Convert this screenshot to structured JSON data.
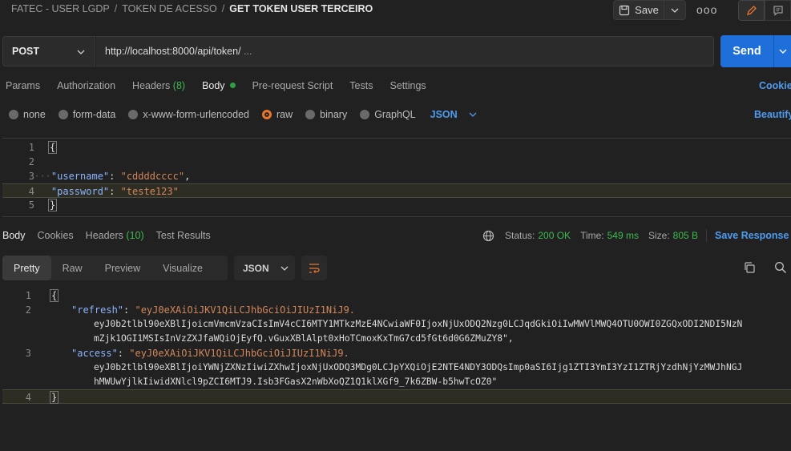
{
  "breadcrumb": [
    "FATEC - USER LGDP",
    "TOKEN DE ACESSO",
    "GET TOKEN USER TERCEIRO"
  ],
  "toolbar": {
    "save_label": "Save",
    "more_label": "ooo"
  },
  "request": {
    "method": "POST",
    "url": "http://localhost:8000/api/token/",
    "url_suffix": "...",
    "send_label": "Send"
  },
  "request_tabs": [
    {
      "label": "Params"
    },
    {
      "label": "Authorization"
    },
    {
      "label": "Headers",
      "count": "(8)"
    },
    {
      "label": "Body",
      "active": true
    },
    {
      "label": "Pre-request Script"
    },
    {
      "label": "Tests"
    },
    {
      "label": "Settings"
    }
  ],
  "cookies_label": "Cookie",
  "body_types": [
    "none",
    "form-data",
    "x-www-form-urlencoded",
    "raw",
    "binary",
    "GraphQL"
  ],
  "body_type_selected": "raw",
  "body_language": "JSON",
  "beautify_label": "Beautify",
  "request_body": {
    "line_numbers": [
      "1",
      "2",
      "3",
      "4",
      "5"
    ],
    "l1": "{",
    "l3_key": "\"username\"",
    "l3_val": "\"cddddcccc\"",
    "l4_key": "\"password\"",
    "l4_val": "\"teste123\"",
    "l5": "}"
  },
  "response_tabs": [
    {
      "label": "Body",
      "active": true
    },
    {
      "label": "Cookies"
    },
    {
      "label": "Headers",
      "count": "(10)"
    },
    {
      "label": "Test Results"
    }
  ],
  "response_meta": {
    "status_label": "Status:",
    "status": "200 OK",
    "time_label": "Time:",
    "time": "549 ms",
    "size_label": "Size:",
    "size": "805 B",
    "save_response": "Save Response"
  },
  "response_views": [
    "Pretty",
    "Raw",
    "Preview",
    "Visualize"
  ],
  "response_format": "JSON",
  "response_body": {
    "line_numbers": [
      "1",
      "2",
      "3",
      "4"
    ],
    "l1": "{",
    "refresh_key": "\"refresh\"",
    "refresh_1": "\"eyJ0eXAiOiJKV1QiLCJhbGciOiJIUzI1NiJ9.",
    "refresh_2": "eyJ0b2tlbl90eXBlIjoicmVmcmVzaCIsImV4cCI6MTY1MTkzMzE4NCwiaWF0IjoxNjUxODQ2Nzg0LCJqdGkiOiIwMWVlMWQ4OTU0OWI0ZGQxODI2NDI5NzN",
    "refresh_3": "mZjk1OGI1MSIsInVzZXJfaWQiOjEyfQ.vGuxXBlAlpt0xHoTCmoxKxTmG7cd5fGt6d0G6ZMuZY8\",",
    "access_key": "\"access\"",
    "access_1": "\"eyJ0eXAiOiJKV1QiLCJhbGciOiJIUzI1NiJ9.",
    "access_2": "eyJ0b2tlbl90eXBlIjoiYWNjZXNzIiwiZXhwIjoxNjUxODQ3MDg0LCJpYXQiOjE2NTE4NDY3ODQsImp0aSI6Ijg1ZTI3YmI3YzI1ZTRjYzdhNjYzMWJhNGJ",
    "access_3": "hMWUwYjlkIiwidXNlcl9pZCI6MTJ9.Isb3FGasX2nWbXoQZ1Q1klXGf9_7k6ZBW-b5hwTcOZ0\"",
    "l4": "}"
  },
  "colors": {
    "accent_blue": "#1f6fdb",
    "status_green": "#3fb950",
    "raw_orange": "#e8762e"
  }
}
